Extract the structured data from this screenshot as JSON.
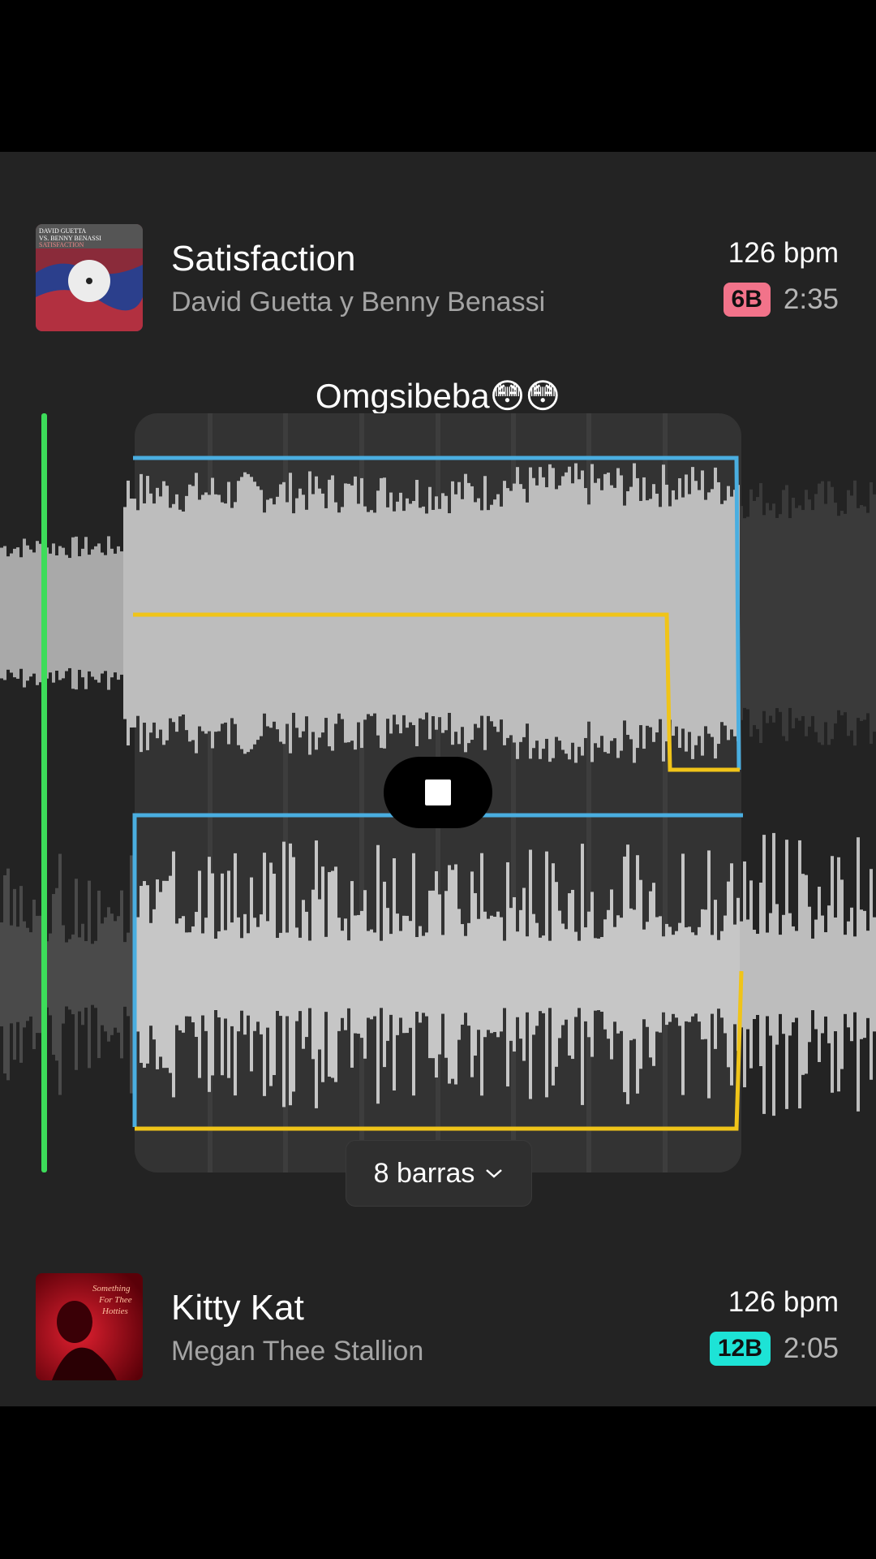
{
  "caption": "Omgsibeba😳😳",
  "track_top": {
    "title": "Satisfaction",
    "artist": "David Guetta y Benny Benassi",
    "bpm": "126 bpm",
    "key": "6B",
    "key_color": "#f2738a",
    "duration": "2:35",
    "art_text": "DAVID GUETTA VS. BENNY BENASSI SATISFACTION"
  },
  "track_bottom": {
    "title": "Kitty Kat",
    "artist": "Megan Thee Stallion",
    "bpm": "126 bpm",
    "key": "12B",
    "key_color": "#1de3d6",
    "duration": "2:05",
    "art_text": "Something For Thee Hotties"
  },
  "transition": {
    "bars_label": "8 barras",
    "playhead_color": "#3ddc5a",
    "blue_line_color": "#4aaee0",
    "yellow_line_color": "#f0c419",
    "wave_color": "#b9b9b9"
  },
  "icons": {
    "stop": "stop-icon",
    "dropdown": "chevron-down-icon"
  }
}
